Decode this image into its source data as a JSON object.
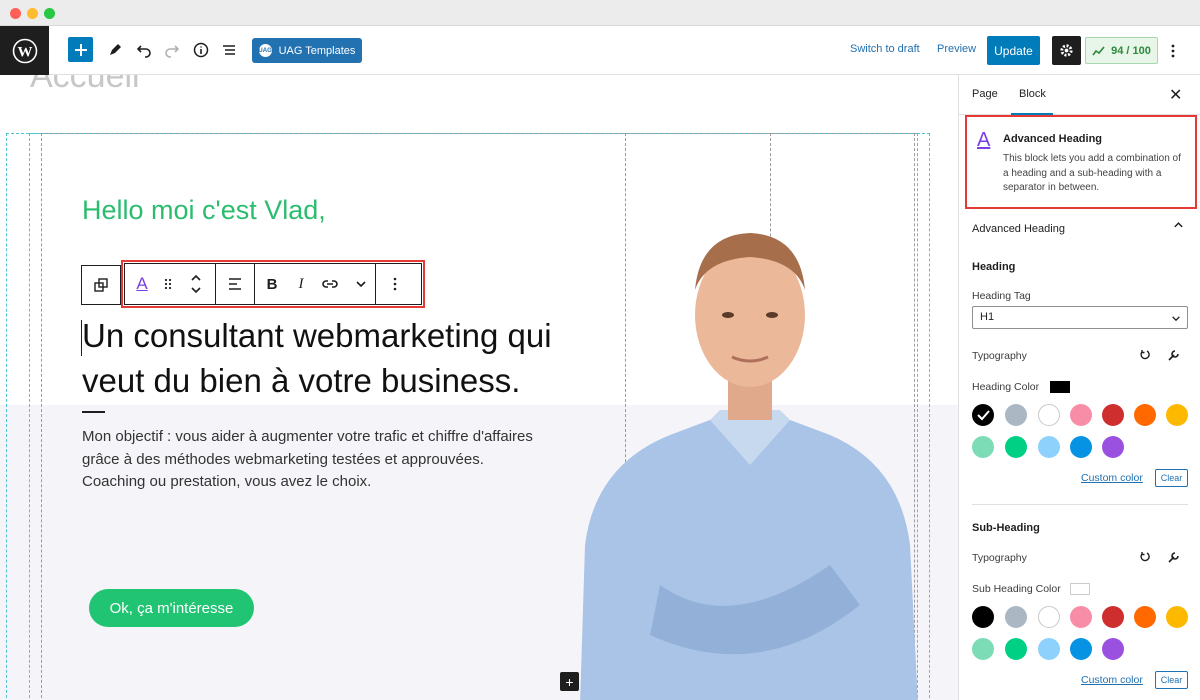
{
  "window": {
    "dot_colors": [
      "#ff5f57",
      "#febc2e",
      "#28c840"
    ]
  },
  "topbar": {
    "logo_icon": "wordpress-logo-icon",
    "add_icon": "plus-icon",
    "tools_icon": "pencil-icon",
    "undo_icon": "undo-icon",
    "redo_icon": "redo-icon",
    "info_icon": "info-icon",
    "outline_icon": "list-view-icon",
    "uag_badge": "UAG",
    "uag_label": "UAG Templates",
    "switch_draft": "Switch to draft",
    "preview": "Preview",
    "update": "Update",
    "settings_icon": "gear-icon",
    "score_label": "94 / 100",
    "more_icon": "vertical-ellipsis-icon"
  },
  "canvas": {
    "page_title": "Accueil",
    "hello": "Hello moi c'est Vlad,",
    "heading_line1": "Un consultant webmarketing qui",
    "heading_line2": "veut du bien à votre business.",
    "desc_line1": "Mon objectif : vous aider à augmenter votre trafic et chiffre d'affaires",
    "desc_line2": "grâce à des méthodes webmarketing testées et approuvées.",
    "desc_line3": "Coaching ou prestation, vous avez le choix.",
    "cta": "Ok, ça m'intéresse",
    "plus": "+"
  },
  "block_toolbar": {
    "block_icon": "advanced-heading-icon",
    "items": [
      "B",
      "I"
    ]
  },
  "sidebar": {
    "tab_page": "Page",
    "tab_block": "Block",
    "close": "✕",
    "card_icon": "A",
    "card_title": "Advanced Heading",
    "card_desc": "This block lets you add a combination of a heading and a sub-heading with a separator in between.",
    "panel_title": "Advanced Heading",
    "section_heading": "Heading",
    "heading_tag_label": "Heading Tag",
    "heading_tag_value": "H1",
    "typography": "Typography",
    "heading_color_label": "Heading Color",
    "heading_color": "#000000",
    "custom_color": "Custom color",
    "clear": "Clear",
    "section_subheading": "Sub-Heading",
    "typography2": "Typography",
    "sub_heading_color_label": "Sub Heading Color",
    "sub_heading_color": "#ffffff",
    "custom_color2": "Custom color",
    "clear2": "Clear",
    "palette": [
      "#000000",
      "#abb8c3",
      "#ffffff",
      "#f78da7",
      "#cf2e2e",
      "#ff6900",
      "#fcb900",
      "#7bdcb5",
      "#00d084",
      "#8ed1fc",
      "#0693e3",
      "#9b51e0"
    ]
  }
}
